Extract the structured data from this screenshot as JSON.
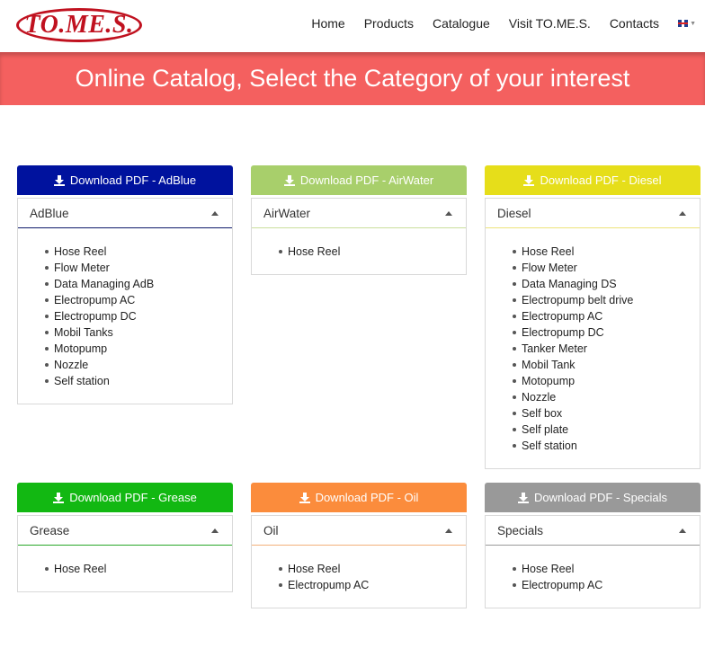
{
  "header": {
    "logo_text": "TO.ME.S.",
    "nav": [
      "Home",
      "Products",
      "Catalogue",
      "Visit TO.ME.S.",
      "Contacts"
    ],
    "language_flag": "uk-flag-icon"
  },
  "banner": {
    "title": "Online Catalog, Select the Category of your interest"
  },
  "categories": [
    {
      "button": "Download PDF - AdBlue",
      "color": "#00129e",
      "line": "#0e1a6a",
      "title": "AdBlue",
      "items": [
        "Hose Reel",
        "Flow Meter",
        "Data Managing AdB",
        "Electropump AC",
        "Electropump DC",
        "Mobil Tanks",
        "Motopump",
        "Nozzle",
        "Self station"
      ]
    },
    {
      "button": "Download PDF - AirWater",
      "color": "#a8cf6b",
      "line": "#c9df9c",
      "title": "AirWater",
      "items": [
        "Hose Reel"
      ]
    },
    {
      "button": "Download PDF - Diesel",
      "color": "#e6de1a",
      "line": "#ede37a",
      "title": "Diesel",
      "items": [
        "Hose Reel",
        "Flow Meter",
        "Data Managing DS",
        "Electropump belt drive",
        "Electropump AC",
        "Electropump DC",
        "Tanker Meter",
        "Mobil Tank",
        "Motopump",
        "Nozzle",
        "Self box",
        "Self plate",
        "Self station"
      ]
    },
    {
      "button": "Download PDF - Grease",
      "color": "#12b812",
      "line": "#29a829",
      "title": "Grease",
      "items": [
        "Hose Reel"
      ]
    },
    {
      "button": "Download PDF - Oil",
      "color": "#fb8c3c",
      "line": "#f3b07a",
      "title": "Oil",
      "items": [
        "Hose Reel",
        "Electropump AC"
      ]
    },
    {
      "button": "Download PDF - Specials",
      "color": "#999999",
      "line": "#9a9a9a",
      "title": "Specials",
      "items": [
        "Hose Reel",
        "Electropump AC"
      ]
    }
  ]
}
